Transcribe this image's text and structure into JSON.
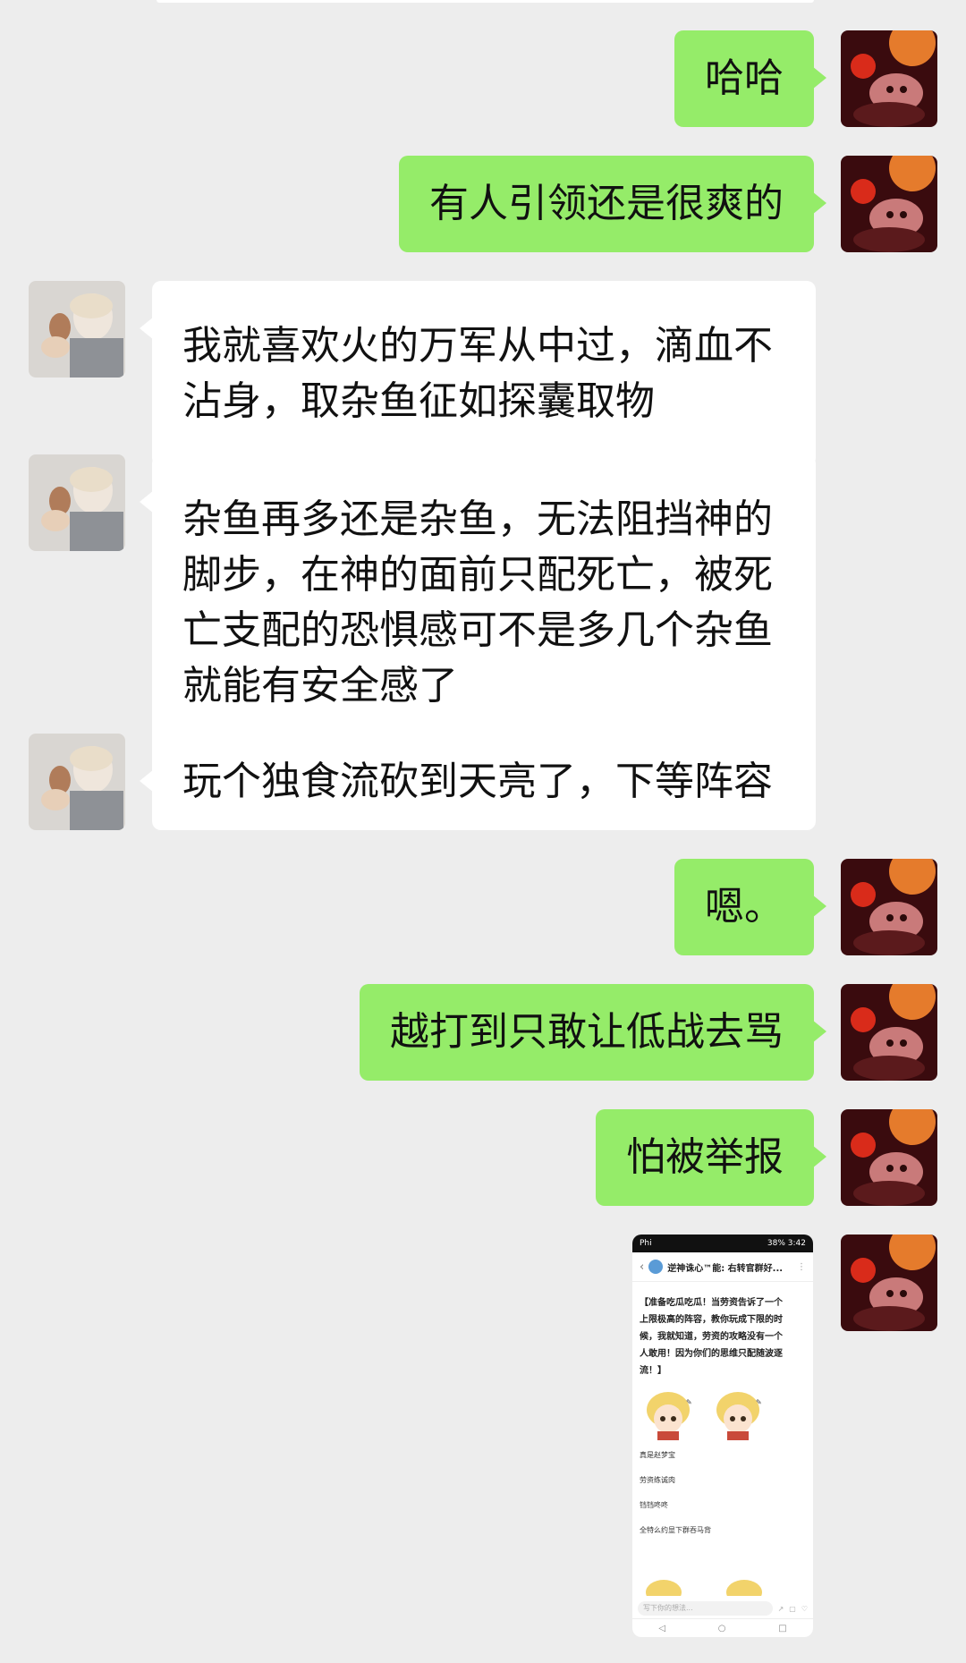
{
  "messages": [
    {
      "side": "me",
      "text": "哈哈"
    },
    {
      "side": "me",
      "text": "有人引领还是很爽的"
    },
    {
      "side": "other",
      "lines": [
        "我就喜欢火的万军从中过，滴血不",
        "沾身，取杂鱼征如探囊取物"
      ]
    },
    {
      "side": "other",
      "lines": [
        "杂鱼再多还是杂鱼，无法阻挡神的",
        "脚步，在神的面前只配死亡，被死",
        "亡支配的恐惧感可不是多几个杂鱼",
        "就能有安全感了"
      ]
    },
    {
      "side": "other",
      "text": "玩个独食流砍到天亮了，下等阵容"
    },
    {
      "side": "me",
      "text": "嗯。"
    },
    {
      "side": "me",
      "text": "越打到只敢让低战去骂"
    },
    {
      "side": "me",
      "text": "怕被举报"
    }
  ],
  "screenshot_message": {
    "status_left": "Phi",
    "status_right": "38% 3:42",
    "header_title": "逆神诛心™能: 右转官群好...",
    "body_lines": [
      "【准备吃瓜吃瓜！当劳资告诉了一个",
      "上限极高的阵容，教你玩成下限的时",
      "候，我就知道，劳资的攻略没有一个",
      "人敢用！因为你们的思维只配随波逐",
      "流！】"
    ],
    "caption_lines": [
      "真是赵梦宝",
      "劳资练诚肉",
      "铛铛咚咚",
      "全特么约显下群吞马背"
    ],
    "input_placeholder": "写下你的想法...",
    "nav": [
      "◁",
      "○",
      "□"
    ]
  },
  "colors": {
    "my_bubble": "#95ec69",
    "their_bubble": "#ffffff",
    "background": "#ededed"
  }
}
